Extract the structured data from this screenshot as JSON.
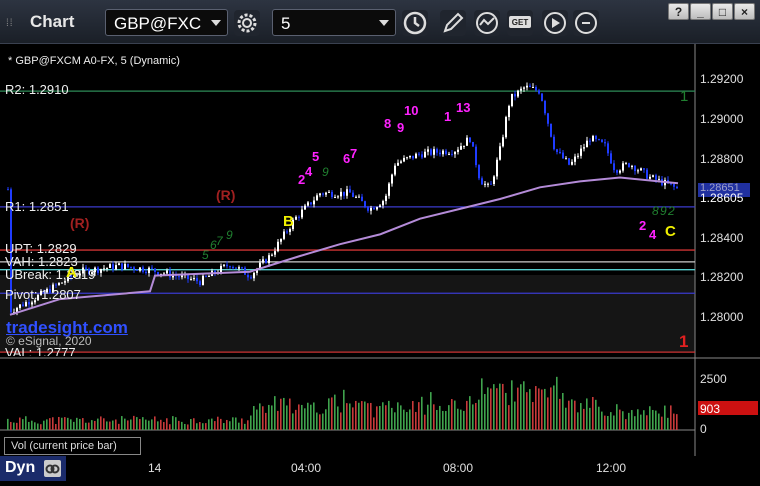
{
  "window": {
    "title": "Chart",
    "symbol": "GBP@FXC",
    "interval": "5",
    "controls": [
      "?",
      "_",
      "□",
      "×"
    ]
  },
  "chart_info": {
    "header": "* GBP@FXCM A0-FX, 5 (Dynamic)",
    "watermark": "tradesight.com",
    "copyright": "© eSignal, 2020",
    "vol_label": "Vol (current price bar)",
    "bottom_tab": "Dyn"
  },
  "levels": [
    {
      "label": "R2: 1.2910",
      "value": 1.291,
      "color": "#2e8b57"
    },
    {
      "label": "R1: 1.2851",
      "value": 1.2851,
      "color": "#3a3acc"
    },
    {
      "label": "UPT: 1.2829",
      "value": 1.2829,
      "color": "#cc3333"
    },
    {
      "label": "VAH: 1.2823",
      "value": 1.2823,
      "color": "#cccccc"
    },
    {
      "label": "UBreak: 1.2819",
      "value": 1.2819,
      "color": "#55cccc"
    },
    {
      "label": "Pivot: 1.2807",
      "value": 1.2807,
      "color": "#3a3acc"
    },
    {
      "label": "VAL: 1.2777",
      "value": 1.2777,
      "color": "#cc3333"
    }
  ],
  "price_axis": {
    "ticks": [
      "1.29200",
      "1.29000",
      "1.28800",
      "1.28400",
      "1.28200",
      "1.28000"
    ],
    "current_price": "1.28605",
    "prev_price": "1.28651",
    "range": [
      1.2774,
      1.2934
    ]
  },
  "volume_axis": {
    "ticks": [
      "2500",
      "0"
    ],
    "current": "903",
    "range": [
      0,
      3300
    ]
  },
  "time_axis": {
    "labels": [
      "14",
      "04:00",
      "08:00",
      "12:00"
    ]
  },
  "annotations": {
    "letters": [
      "A",
      "B",
      "C"
    ],
    "r_marks": [
      "(R)",
      "(R)"
    ],
    "magenta_counts": [
      "2",
      "4",
      "5",
      "6",
      "7",
      "8",
      "9",
      "10",
      "1",
      "13",
      "2",
      "4"
    ],
    "green_counts": [
      "5",
      "6",
      "7",
      "9",
      "9",
      "8",
      "9",
      "2"
    ],
    "right_marks": [
      "1",
      "1"
    ]
  },
  "colors": {
    "candle_up": "#ffffff",
    "candle_down": "#1f3cff",
    "vwap": "#b48bd8",
    "vol_up": "#3fa34d",
    "vol_down": "#c83a3a"
  }
}
